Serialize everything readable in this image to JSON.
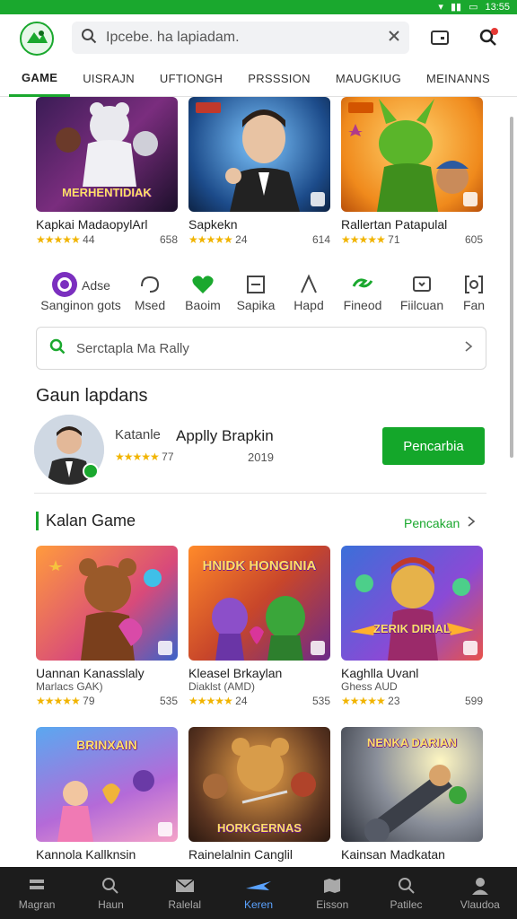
{
  "status": {
    "time": "13:55"
  },
  "search": {
    "text": "Ipcebe. ha lapiadam."
  },
  "tabs": [
    {
      "label": "GAME"
    },
    {
      "label": "UISRAJN"
    },
    {
      "label": "UFTIONGH"
    },
    {
      "label": "PRSSSION"
    },
    {
      "label": "MAUGKIUG"
    },
    {
      "label": "MEINANNS"
    }
  ],
  "top_games": [
    {
      "title": "Kapkai MadaopylArl",
      "rating": "44",
      "count": "658",
      "art": "MERHENTIDIAK"
    },
    {
      "title": "Sapkekn",
      "rating": "24",
      "count": "614",
      "art": ""
    },
    {
      "title": "Rallertan Patapulal",
      "rating": "71",
      "count": "605",
      "art": ""
    }
  ],
  "categories": [
    {
      "label": "Sanginon gots",
      "icon_text": "Adse"
    },
    {
      "label": "Msed",
      "icon_text": ""
    },
    {
      "label": "Baoim",
      "icon_text": ""
    },
    {
      "label": "Sapika",
      "icon_text": ""
    },
    {
      "label": "Hapd",
      "icon_text": ""
    },
    {
      "label": "Fineod",
      "icon_text": ""
    },
    {
      "label": "Fiilcuan",
      "icon_text": ""
    },
    {
      "label": "Fan",
      "icon_text": ""
    }
  ],
  "searchbox": {
    "text": "Serctapla Ma Rally"
  },
  "featured": {
    "heading": "Gaun lapdans",
    "name": "Katanle",
    "title": "Applly Brapkin",
    "rating": "77",
    "year": "2019",
    "button": "Pencarbia"
  },
  "section": {
    "title": "Kalan Game",
    "see_all": "Pencakan"
  },
  "games": [
    {
      "title": "Uannan Kanasslaly",
      "sub": "Marlacs GAK)",
      "rating": "79",
      "count": "535",
      "art": ""
    },
    {
      "title": "Kleasel Brkaylan",
      "sub": "Diaklst (AMD)",
      "rating": "24",
      "count": "535",
      "art": "HNIDK HONGINIA"
    },
    {
      "title": "Kaghlla Uvanl",
      "sub": "Ghess AUD",
      "rating": "23",
      "count": "599",
      "art": "ZERIK DIRIAL"
    },
    {
      "title": "Kannola Kallknsin",
      "sub": "",
      "rating": "",
      "count": "",
      "art": "BRINXAIN"
    },
    {
      "title": "Rainelalnin Canglil",
      "sub": "",
      "rating": "",
      "count": "",
      "art": "HORKGERNAS"
    },
    {
      "title": "Kainsan Madkatan",
      "sub": "",
      "rating": "",
      "count": "",
      "art": "NENKA DARIAN"
    }
  ],
  "bottom_nav": [
    {
      "label": "Magran",
      "icon": "menu-icon"
    },
    {
      "label": "Haun",
      "icon": "search-icon"
    },
    {
      "label": "Ralelal",
      "icon": "mail-icon"
    },
    {
      "label": "Keren",
      "icon": "plane-icon",
      "active": true
    },
    {
      "label": "Eisson",
      "icon": "map-icon"
    },
    {
      "label": "Patilec",
      "icon": "search-icon"
    },
    {
      "label": "Vlaudoa",
      "icon": "person-icon"
    }
  ],
  "colors": {
    "accent": "#1aa82e",
    "nav_active": "#5aa2ff",
    "star": "#f1b400"
  }
}
